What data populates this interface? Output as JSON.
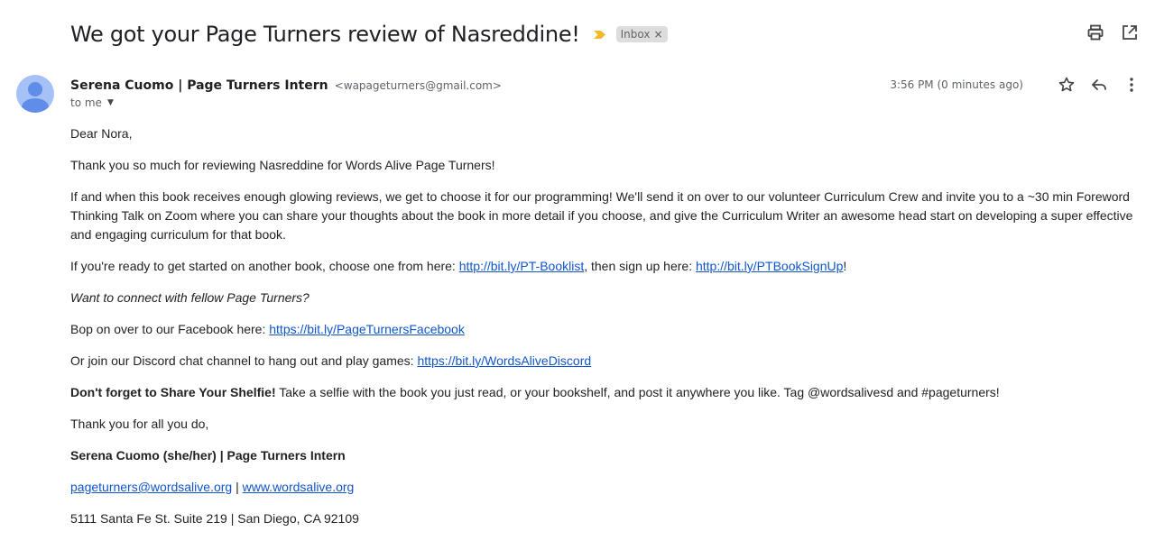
{
  "email": {
    "subject": "We got your Page Turners review of Nasreddine!",
    "label": "Inbox",
    "label_remove": "×",
    "sender": {
      "name": "Serena Cuomo | Page Turners Intern",
      "email": "<wapageturners@gmail.com>"
    },
    "recipient_line": "to me",
    "timestamp": "3:56 PM (0 minutes ago)",
    "colors": {
      "importance": "#f2b92c",
      "link": "#1155cc",
      "avatar_bg": "#a5c1f6",
      "avatar_fg": "#5f8de8",
      "label_bg": "#dddddd"
    },
    "icons": {
      "print": "print-icon",
      "popout": "open-in-new-window-icon",
      "star": "star-icon",
      "reply": "reply-icon",
      "more": "more-options-icon",
      "importance": "importance-marker-icon",
      "avatar": "default-avatar-icon"
    }
  },
  "body": {
    "greeting": "Dear Nora,",
    "thanks": "Thank you so much for reviewing Nasreddine for Words Alive Page Turners!",
    "program_paragraph": "If and when this book receives enough glowing reviews, we get to choose it for our programming! We'll send it on over to our volunteer Curriculum Crew and invite you to a ~30 min Foreword Thinking Talk on Zoom where you can share your thoughts about the book in more detail if you choose, and give the Curriculum Writer an awesome head start on developing a super effective and engaging curriculum for that book.",
    "next_book": {
      "text1": "If you're ready to get started on another book, choose one from here: ",
      "link1": "http://bit.ly/PT-Booklist",
      "text2": ", then sign up here: ",
      "link2": "http://bit.ly/PTBookSignUp",
      "text3": "!"
    },
    "connect_heading": "Want to connect with fellow Page Turners?",
    "facebook": {
      "text": "Bop on over to our Facebook here: ",
      "link": "https://bit.ly/PageTurnersFacebook"
    },
    "discord": {
      "text": "Or join our Discord chat channel to hang out and play games: ",
      "link": "https://bit.ly/WordsAliveDiscord"
    },
    "shelfie": {
      "bold": "Don't forget to Share Your Shelfie!",
      "text": " Take a selfie with the book you just read, or your bookshelf, and post it anywhere you like. Tag @wordsalivesd and #pageturners!"
    },
    "closing": "Thank you for all you do,",
    "signature": {
      "name": "Serena Cuomo (she/her) | Page Turners Intern",
      "email_link": "pageturners@wordsalive.org",
      "separator": " | ",
      "site_link": "www.wordsalive.org",
      "address": "5111 Santa Fe St. Suite 219 | San Diego, CA 92109"
    }
  }
}
